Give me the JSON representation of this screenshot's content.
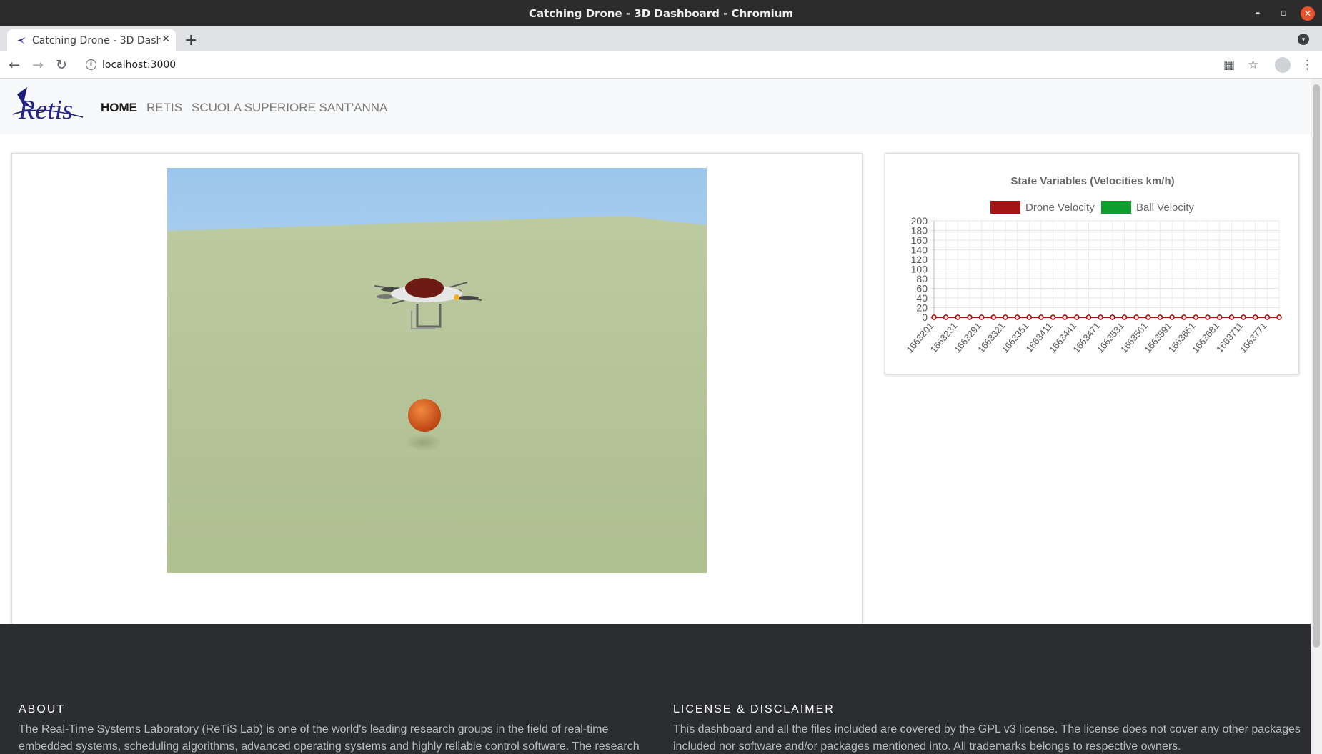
{
  "browser": {
    "window_title": "Catching Drone - 3D Dashboard - Chromium",
    "tab_title": "Catching Drone - 3D Dash",
    "url": "localhost:3000"
  },
  "navbar": {
    "brand": "Retis",
    "links": [
      {
        "label": "HOME",
        "active": true
      },
      {
        "label": "RETIS",
        "active": false
      },
      {
        "label": "SCUOLA SUPERIORE SANT'ANNA",
        "active": false
      }
    ]
  },
  "chart_data": {
    "type": "line",
    "title": "State Variables (Velocities km/h)",
    "series": [
      {
        "name": "Drone Velocity",
        "color": "#a31515",
        "values": [
          0,
          0,
          0,
          0,
          0,
          0,
          0,
          0,
          0,
          0,
          0,
          0,
          0,
          0,
          0,
          0,
          0,
          0,
          0,
          0,
          0,
          0,
          0,
          0,
          0,
          0,
          0,
          0,
          0,
          0
        ]
      },
      {
        "name": "Ball Velocity",
        "color": "#0e9e2e",
        "values": [
          0,
          0,
          0,
          0,
          0,
          0,
          0,
          0,
          0,
          0,
          0,
          0,
          0,
          0,
          0,
          0,
          0,
          0,
          0,
          0,
          0,
          0,
          0,
          0,
          0,
          0,
          0,
          0,
          0,
          0
        ]
      }
    ],
    "x_tick_labels": [
      "1663201",
      "1663231",
      "1663291",
      "1663321",
      "1663351",
      "1663411",
      "1663441",
      "1663471",
      "1663531",
      "1663561",
      "1663591",
      "1663651",
      "1663681",
      "1663711",
      "1663771"
    ],
    "ylim": [
      0,
      200
    ],
    "y_ticks": [
      0,
      20,
      40,
      60,
      80,
      100,
      120,
      140,
      160,
      180,
      200
    ],
    "grid": true,
    "legend": "top"
  },
  "footer": {
    "about_heading": "ABOUT",
    "about_line1": "The Real-Time Systems Laboratory (ReTiS Lab) is one of the world's leading research groups in the field of real-time",
    "about_line2": "embedded systems, scheduling algorithms, advanced operating systems and highly reliable control software. The research",
    "license_heading": "LICENSE & DISCLAIMER",
    "license_line1": "This dashboard and all the files included are covered by the GPL v3 license. The license does not cover any other packages",
    "license_line2": "included nor software and/or packages mentioned into. All trademarks belongs to respective owners."
  }
}
